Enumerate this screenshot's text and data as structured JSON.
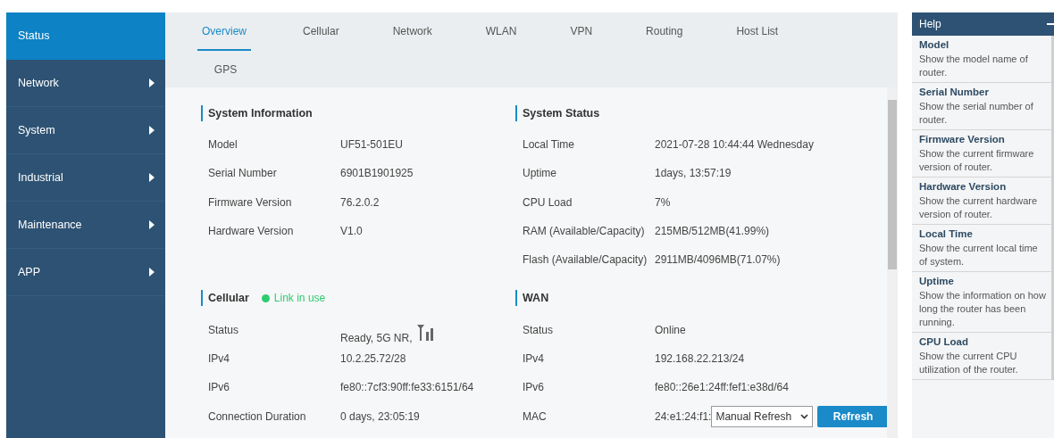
{
  "sidebar": {
    "items": [
      {
        "label": "Status",
        "selected": true,
        "has_submenu": false
      },
      {
        "label": "Network",
        "selected": false,
        "has_submenu": true
      },
      {
        "label": "System",
        "selected": false,
        "has_submenu": true
      },
      {
        "label": "Industrial",
        "selected": false,
        "has_submenu": true
      },
      {
        "label": "Maintenance",
        "selected": false,
        "has_submenu": true
      },
      {
        "label": "APP",
        "selected": false,
        "has_submenu": true
      }
    ]
  },
  "tabs": [
    {
      "label": "Overview",
      "selected": true
    },
    {
      "label": "Cellular",
      "selected": false
    },
    {
      "label": "Network",
      "selected": false
    },
    {
      "label": "WLAN",
      "selected": false
    },
    {
      "label": "VPN",
      "selected": false
    },
    {
      "label": "Routing",
      "selected": false
    },
    {
      "label": "Host List",
      "selected": false
    },
    {
      "label": "GPS",
      "selected": false
    }
  ],
  "sections": [
    {
      "title": "System Information",
      "rows": [
        {
          "kind": "text",
          "label": "Model",
          "value": "UF51-501EU"
        },
        {
          "kind": "text",
          "label": "Serial Number",
          "value": "6901B1901925"
        },
        {
          "kind": "text",
          "label": "Firmware Version",
          "value": "76.2.0.2"
        },
        {
          "kind": "text",
          "label": "Hardware Version",
          "value": "V1.0"
        }
      ]
    },
    {
      "title": "System Status",
      "rows": [
        {
          "kind": "text",
          "label": "Local Time",
          "value": "2021-07-28 10:44:44 Wednesday"
        },
        {
          "kind": "text",
          "label": "Uptime",
          "value": "1days,   13:57:19"
        },
        {
          "kind": "text",
          "label": "CPU Load",
          "value": "7%"
        },
        {
          "kind": "text",
          "label": "RAM (Available/Capacity)",
          "value": "215MB/512MB(41.99%)"
        },
        {
          "kind": "text",
          "label": "Flash (Available/Capacity)",
          "value": "2911MB/4096MB(71.07%)"
        }
      ]
    },
    {
      "title": "Cellular",
      "status": {
        "label": "Link in use",
        "color": "#2ecc71"
      },
      "rows": [
        {
          "kind": "signal",
          "label": "Status",
          "value": "Ready, 5G NR,"
        },
        {
          "kind": "text",
          "label": "IPv4",
          "value": "10.2.25.72/28"
        },
        {
          "kind": "text",
          "label": "IPv6",
          "value": "fe80::7cf3:90ff:fe33:6151/64"
        },
        {
          "kind": "text",
          "label": "Connection Duration",
          "value": "0 days, 23:05:19"
        }
      ]
    },
    {
      "title": "WAN",
      "rows": [
        {
          "kind": "text",
          "label": "Status",
          "value": "Online"
        },
        {
          "kind": "text",
          "label": "IPv4",
          "value": "192.168.22.213/24"
        },
        {
          "kind": "text",
          "label": "IPv6",
          "value": "fe80::26e1:24ff:fef1:e38d/64"
        },
        {
          "kind": "refresh",
          "label": "MAC",
          "value": "24:e1:24:f1:"
        }
      ]
    }
  ],
  "refresh": {
    "interval": "Manual Refresh",
    "button": "Refresh"
  },
  "help": {
    "title": "Help",
    "items": [
      {
        "title": "Model",
        "text": "Show the model name of router."
      },
      {
        "title": "Serial Number",
        "text": "Show the serial number of router."
      },
      {
        "title": "Firmware Version",
        "text": "Show the current firmware version of router."
      },
      {
        "title": "Hardware Version",
        "text": "Show the current hardware version of router."
      },
      {
        "title": "Local Time",
        "text": "Show the current local time of system."
      },
      {
        "title": "Uptime",
        "text": "Show the information on how long the router has been running."
      },
      {
        "title": "CPU Load",
        "text": "Show the current CPU utilization of the router."
      }
    ]
  }
}
